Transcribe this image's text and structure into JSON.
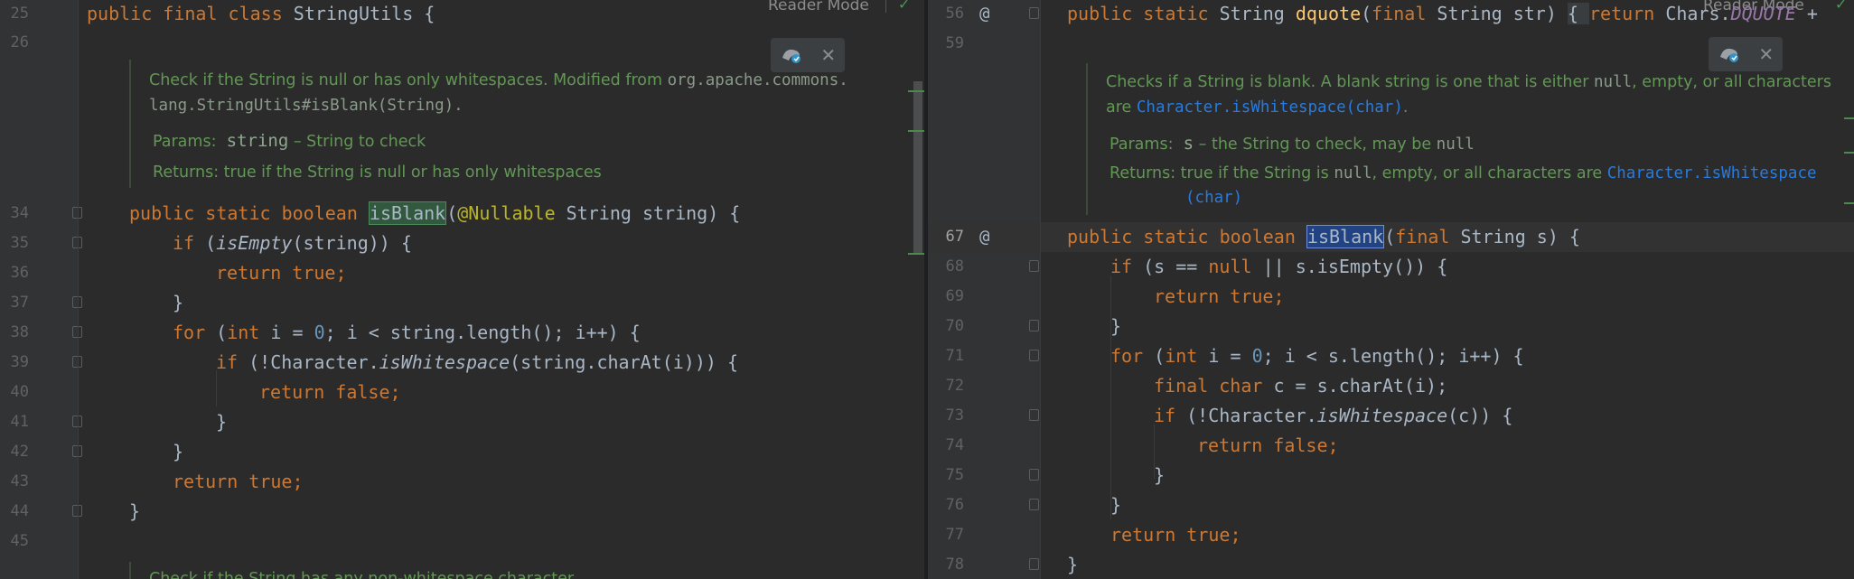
{
  "left": {
    "reader_mode": "Reader Mode",
    "lines": {
      "l25": {
        "num": "25",
        "kw": "public final class ",
        "name": "StringUtils {"
      },
      "l26": {
        "num": "26"
      },
      "l34": {
        "num": "34",
        "kw": "public static boolean ",
        "method": "isBlank",
        "open": "(",
        "ann": "@Nullable",
        "rest": " String string) {"
      },
      "l35": {
        "num": "35",
        "kw": "if ",
        "p1": "(",
        "it": "isEmpty",
        "rest": "(string)) {"
      },
      "l36": {
        "num": "36",
        "kw": "return true;"
      },
      "l37": {
        "num": "37",
        "txt": "}"
      },
      "l38": {
        "num": "38",
        "kw1": "for ",
        "p1": "(",
        "kw2": "int ",
        "t1": "i = ",
        "n1": "0",
        "t2": "; i < string.length(); i++) {"
      },
      "l39": {
        "num": "39",
        "kw": "if ",
        "t1": "(!Character.",
        "it": "isWhitespace",
        "t2": "(string.charAt(i))) {"
      },
      "l40": {
        "num": "40",
        "kw": "return false;"
      },
      "l41": {
        "num": "41",
        "txt": "}"
      },
      "l42": {
        "num": "42",
        "txt": "}"
      },
      "l43": {
        "num": "43",
        "kw": "return true;"
      },
      "l44": {
        "num": "44",
        "txt": "}"
      },
      "l45": {
        "num": "45"
      }
    },
    "doc": {
      "line1a": "Check if the String is null or has only whitespaces. Modified from ",
      "line1b": "org.apache.commons.",
      "line2": "lang.StringUtils#isBlank(String).",
      "params_label": "Params:",
      "params_name": "string",
      "params_desc": " – String to check",
      "returns_label": "Returns:",
      "returns_desc": "true if the String is null or has only whitespaces"
    },
    "next_doc": "Check if the String has any non-whitespace character."
  },
  "right": {
    "reader_mode": "Reader Mode",
    "lines": {
      "l56": {
        "num": "56",
        "at": "@",
        "kw": "public static ",
        "t1": "String ",
        "method": "dquote",
        "p1": "(",
        "kw2": "final ",
        "t2": "String str) ",
        "brace": "{ ",
        "kw3": "return ",
        "t3": "Chars.",
        "field": "DQUOTE",
        "t4": " + "
      },
      "l59": {
        "num": "59"
      },
      "l67": {
        "num": "67",
        "at": "@",
        "kw": "public static boolean ",
        "method": "isBlank",
        "p1": "(",
        "kw2": "final ",
        "rest": "String s) {"
      },
      "l68": {
        "num": "68",
        "kw": "if ",
        "t1": "(s == ",
        "kw2": "null ",
        "t2": "|| s.isEmpty()) {"
      },
      "l69": {
        "num": "69",
        "kw": "return true;"
      },
      "l70": {
        "num": "70",
        "txt": "}"
      },
      "l71": {
        "num": "71",
        "kw1": "for ",
        "p1": "(",
        "kw2": "int ",
        "t1": "i = ",
        "n1": "0",
        "t2": "; i < s.length(); i++) {"
      },
      "l72": {
        "num": "72",
        "kw": "final char ",
        "t1": "c = s.charAt(i);"
      },
      "l73": {
        "num": "73",
        "kw": "if ",
        "t1": "(!Character.",
        "it": "isWhitespace",
        "t2": "(c)) {"
      },
      "l74": {
        "num": "74",
        "kw": "return false;"
      },
      "l75": {
        "num": "75",
        "txt": "}"
      },
      "l76": {
        "num": "76",
        "txt": "}"
      },
      "l77": {
        "num": "77",
        "kw": "return true;"
      },
      "l78": {
        "num": "78",
        "txt": "}"
      }
    },
    "doc": {
      "line1a": "Checks if a String is blank. A blank string is one that is either ",
      "line1b": "null",
      "line1c": ", empty, or all characters",
      "line2a": "are ",
      "line2b": "Character.isWhitespace(char)",
      "line2c": ".",
      "params_label": "Params:",
      "params_name": "s",
      "params_desc": " – the String to check, may be ",
      "params_null": "null",
      "returns_label": "Returns:",
      "returns_a": "true if the String is ",
      "returns_null": "null",
      "returns_b": ", empty, or all characters are ",
      "returns_link": "Character.isWhitespace",
      "returns_link2": "(char)"
    }
  },
  "colors": {
    "background": "#2b2b2b",
    "keyword": "#cc7832",
    "number": "#6897bb",
    "doc_green": "#629755",
    "annotation": "#bbb529",
    "link": "#287bde",
    "match_highlight": "#32593d",
    "selection_highlight": "#214283"
  }
}
